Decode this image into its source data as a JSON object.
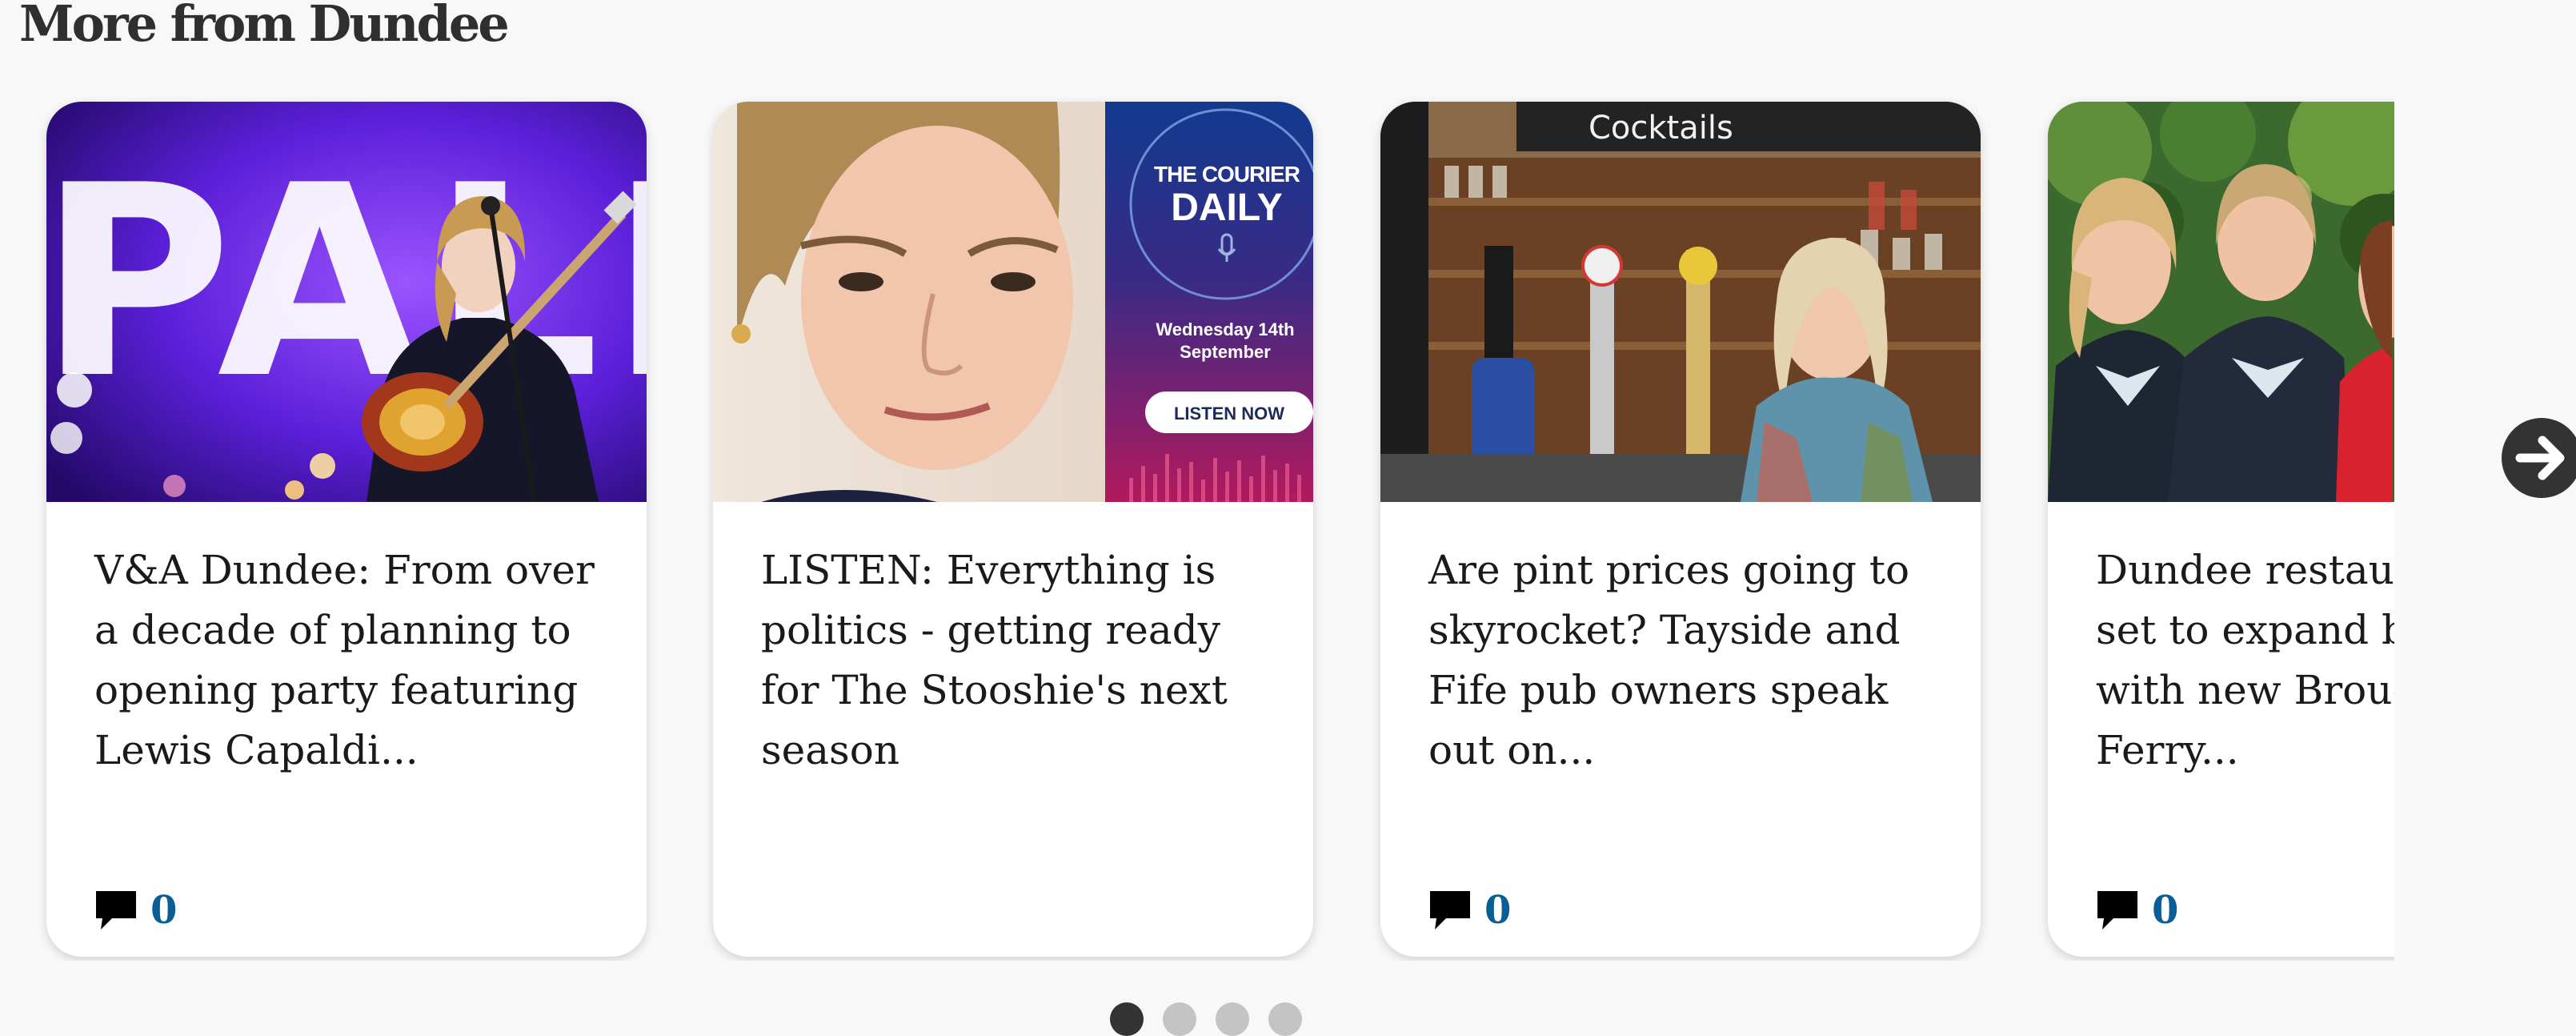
{
  "section": {
    "title": "More from Dundee"
  },
  "cards": [
    {
      "headline": "V&A Dundee: From over a decade of planning to opening party featuring Lewis Capaldi...",
      "comment_count": "0",
      "image_text": "PALDI"
    },
    {
      "headline": "LISTEN: Everything is politics - getting ready for The Stooshie's next season",
      "image_brand": "THE COURIER",
      "image_title": "DAILY",
      "image_date": "Wednesday 14th",
      "image_month": "September",
      "image_cta": "LISTEN NOW"
    },
    {
      "headline": "Are pint prices going to skyrocket? Tayside and Fife pub owners speak out on...",
      "comment_count": "0",
      "image_sign": "Cocktails"
    },
    {
      "headline": "Dundee restaurant Selkie set to expand business with new Broughty Ferry...",
      "comment_count": "0"
    }
  ],
  "carousel": {
    "page_count": 4,
    "current_page": 1
  },
  "colors": {
    "comment_count": "#0a5e96",
    "next_button": "#333333",
    "dot_active": "#333333",
    "dot_inactive": "#c4c4c4"
  },
  "icons": {
    "comment": "speech-bubble-icon",
    "next": "arrow-right-icon"
  }
}
